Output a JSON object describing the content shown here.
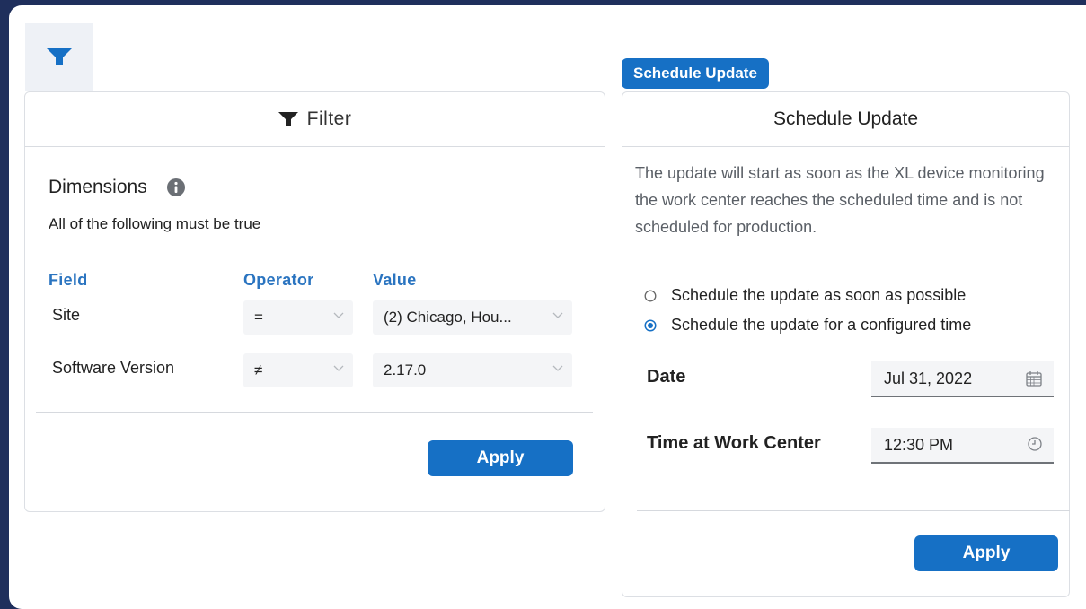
{
  "filter_panel": {
    "title": "Filter",
    "dimensions_title": "Dimensions",
    "subtitle": "All of the following must be true",
    "columns": {
      "field": "Field",
      "operator": "Operator",
      "value": "Value"
    },
    "rows": [
      {
        "field": "Site",
        "operator": "=",
        "value": "(2) Chicago, Hou..."
      },
      {
        "field": "Software Version",
        "operator": "≠",
        "value": "2.17.0"
      }
    ],
    "apply_label": "Apply"
  },
  "schedule_panel": {
    "badge": "Schedule Update",
    "title": "Schedule Update",
    "description": "The update will start as soon as the XL device monitoring the work center reaches the scheduled time and is not scheduled for production.",
    "options": [
      {
        "label": "Schedule the update as soon as possible",
        "selected": false
      },
      {
        "label": "Schedule the update for a configured time",
        "selected": true
      }
    ],
    "date_label": "Date",
    "date_value": "Jul 31, 2022",
    "time_label": "Time at Work Center",
    "time_value": "12:30 PM",
    "apply_label": "Apply"
  },
  "colors": {
    "accent": "#1670c5",
    "background": "#1f2f5c",
    "header_blue": "#2a74c0"
  },
  "icons": [
    "filter-icon",
    "info-icon",
    "chevron-down-icon",
    "calendar-icon",
    "clock-icon",
    "radio-icon"
  ]
}
